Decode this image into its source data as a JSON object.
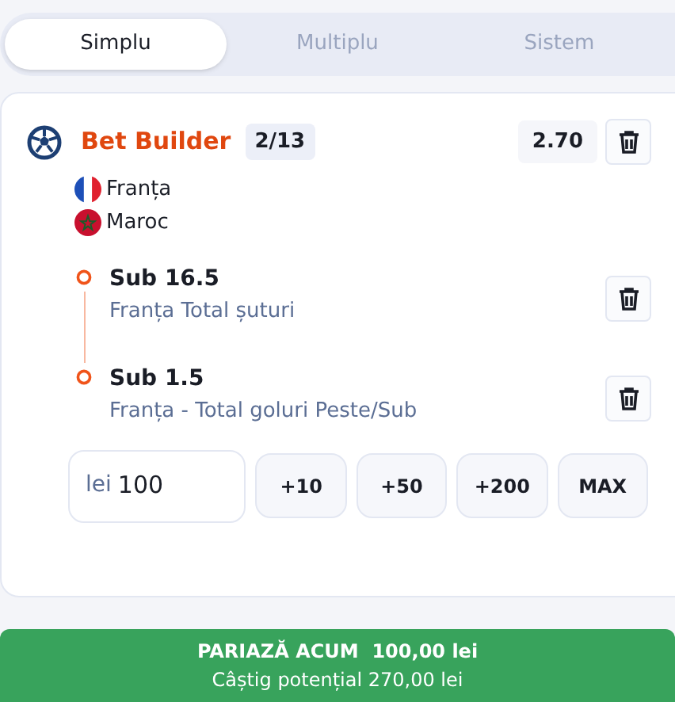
{
  "tabs": [
    {
      "label": "Simplu",
      "selected": true
    },
    {
      "label": "Multiplu",
      "selected": false
    },
    {
      "label": "Sistem",
      "selected": false
    }
  ],
  "bet": {
    "title": "Bet Builder",
    "count": "2/13",
    "odds": "2.70",
    "teams": [
      {
        "name": "Franța",
        "kind": "france"
      },
      {
        "name": "Maroc",
        "kind": "morocco"
      }
    ],
    "selections": [
      {
        "pick": "Sub 16.5",
        "market": "Franța Total șuturi"
      },
      {
        "pick": "Sub 1.5",
        "market": "Franța - Total goluri Peste/Sub"
      }
    ]
  },
  "stake": {
    "currency": "lei",
    "value": "100",
    "quick": [
      "+10",
      "+50",
      "+200",
      "MAX"
    ]
  },
  "place_button": {
    "label": "PARIAZĂ ACUM  100,00 lei",
    "potential": "Câștig potențial 270,00 lei"
  }
}
